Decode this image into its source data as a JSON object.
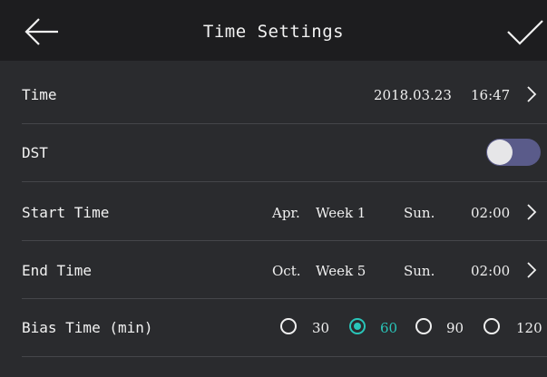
{
  "header": {
    "title": "Time Settings",
    "back_icon": "arrow-left-icon",
    "confirm_icon": "checkmark-icon"
  },
  "time_row": {
    "label": "Time",
    "date": "2018.03.23",
    "clock": "16:47"
  },
  "dst_row": {
    "label": "DST",
    "enabled": false
  },
  "start_time_row": {
    "label": "Start Time",
    "month": "Apr.",
    "week": "Week 1",
    "day": "Sun.",
    "time": "02:00"
  },
  "end_time_row": {
    "label": "End Time",
    "month": "Oct.",
    "week": "Week 5",
    "day": "Sun.",
    "time": "02:00"
  },
  "bias_row": {
    "label": "Bias Time (min)",
    "options": [
      "30",
      "60",
      "90",
      "120"
    ],
    "selected": "60"
  },
  "colors": {
    "accent": "#29c5b9",
    "toggle_track": "#5a5b8a",
    "header_bg": "#1d1d1f",
    "body_bg": "#2a2b2e"
  }
}
